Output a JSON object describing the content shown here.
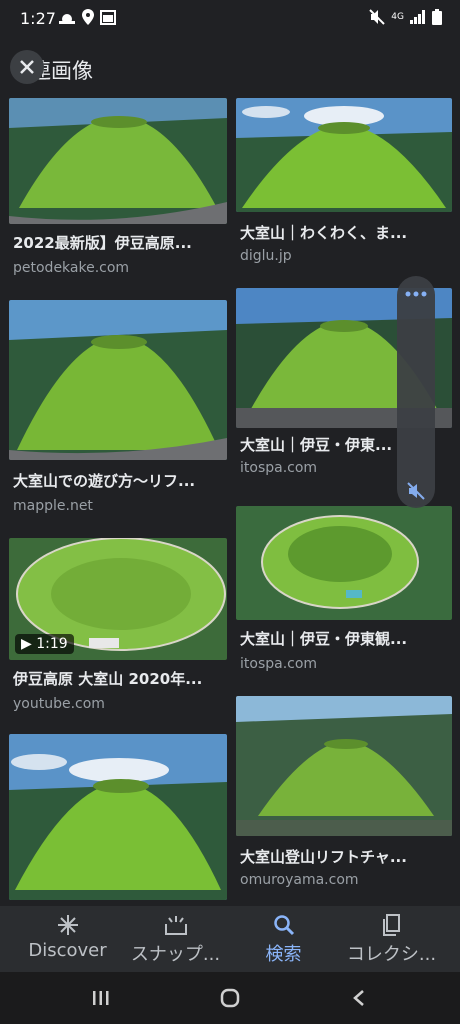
{
  "status": {
    "time": "1:27",
    "network": "4G"
  },
  "header": {
    "title": "連画像"
  },
  "results": [
    {
      "title": "2022最新版】伊豆高原...",
      "source": "petodekake.com",
      "badge": ""
    },
    {
      "title": "大室山｜わくわく、ま...",
      "source": "diglu.jp",
      "badge": ""
    },
    {
      "title": "大室山での遊び方〜リフ...",
      "source": "mapple.net",
      "badge": ""
    },
    {
      "title": "大室山｜伊豆・伊東...",
      "source": "itospa.com",
      "badge": ""
    },
    {
      "title": "伊豆高原 大室山 2020年...",
      "source": "youtube.com",
      "badge": "1:19"
    },
    {
      "title": "大室山｜伊豆・伊東観...",
      "source": "itospa.com",
      "badge": ""
    },
    {
      "title": "",
      "source": "",
      "badge": ""
    },
    {
      "title": "大室山登山リフトチャ...",
      "source": "omuroyama.com",
      "badge": ""
    }
  ],
  "bottom_nav": [
    {
      "label": "Discover",
      "icon": "asterisk-icon"
    },
    {
      "label": "スナップ...",
      "icon": "snapshot-icon"
    },
    {
      "label": "検索",
      "icon": "search-icon"
    },
    {
      "label": "コレクシ...",
      "icon": "collections-icon"
    }
  ],
  "colors": {
    "accent": "#8ab4f8",
    "background": "#202124"
  }
}
